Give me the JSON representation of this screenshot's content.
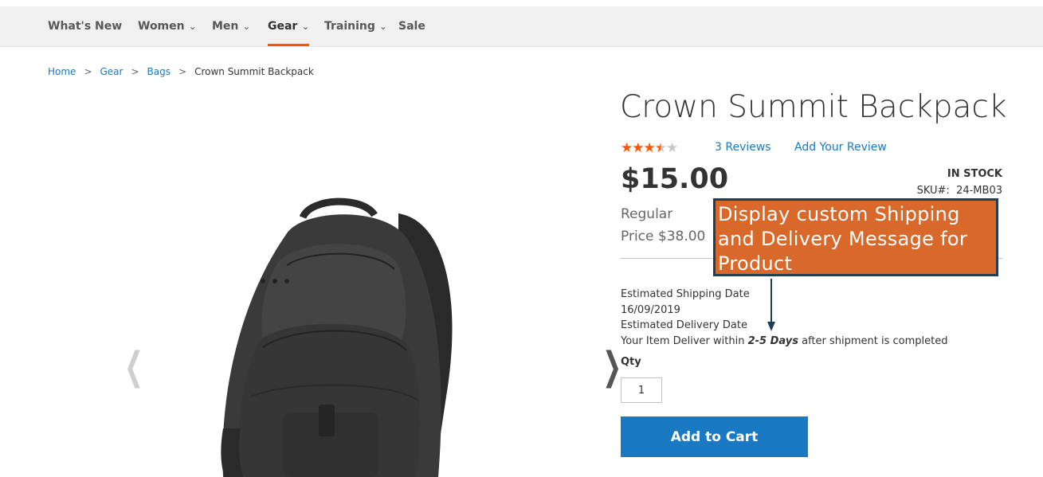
{
  "nav": {
    "items": [
      {
        "label": "What's New",
        "has_dropdown": false,
        "active": false
      },
      {
        "label": "Women",
        "has_dropdown": true,
        "active": false
      },
      {
        "label": "Men",
        "has_dropdown": true,
        "active": false
      },
      {
        "label": "Gear",
        "has_dropdown": true,
        "active": true
      },
      {
        "label": "Training",
        "has_dropdown": true,
        "active": false
      },
      {
        "label": "Sale",
        "has_dropdown": false,
        "active": false
      }
    ],
    "dropdown_icon": "chevron-down-icon"
  },
  "breadcrumb": {
    "items": [
      "Home",
      "Gear",
      "Bags"
    ],
    "current": "Crown Summit Backpack",
    "separator": ">"
  },
  "product": {
    "name": "Crown Summit Backpack",
    "rating": {
      "value": 3.5,
      "max": 5
    },
    "reviews_link": "3  Reviews",
    "add_review_link": "Add Your Review",
    "price": "$15.00",
    "regular_price_label": "Regular",
    "regular_price_value": "Price $38.00",
    "stock": "IN STOCK",
    "sku_label": "SKU#:",
    "sku": "24-MB03",
    "shipping_label": "Estimated Shipping Date",
    "shipping_date": "16/09/2019",
    "delivery_label": "Estimated Delivery Date",
    "delivery_prefix": "Your Item Deliver within ",
    "delivery_days": "2-5 Days",
    "delivery_suffix": " after shipment is completed",
    "qty_label": "Qty",
    "qty_value": "1",
    "add_to_cart": "Add to Cart"
  },
  "callout": {
    "text": "Display custom Shipping and Delivery Message for Product"
  },
  "colors": {
    "accent": "#ff5501",
    "link": "#1979c3",
    "button": "#1979c3",
    "callout_bg": "#d9682b",
    "callout_border": "#1f3f52"
  }
}
